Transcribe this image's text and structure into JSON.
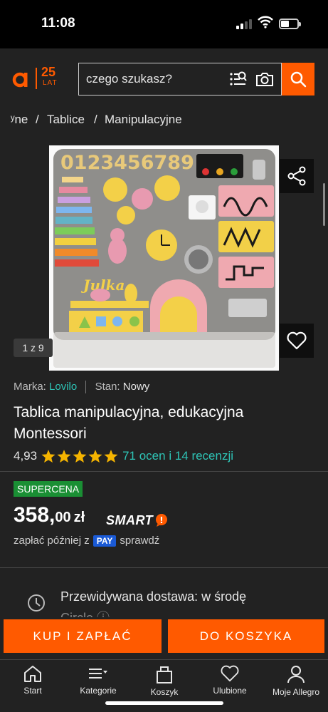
{
  "status_bar": {
    "time": "11:08"
  },
  "header": {
    "logo_number": "25",
    "logo_sub": "LAT",
    "search_placeholder": "czego szukasz?"
  },
  "breadcrumb": [
    "ʸne",
    "/",
    "Tablice",
    "/",
    "Manipulacyjne"
  ],
  "gallery": {
    "counter": "1 z 9",
    "image_text": {
      "digits": "0123456789",
      "name": "Julka"
    }
  },
  "product": {
    "brand_label": "Marka:",
    "brand": "Lovilo",
    "condition_label": "Stan:",
    "condition": "Nowy",
    "title": "Tablica manipulacyjna, edukacyjna Montessori",
    "rating_value": "4,93",
    "stars": 5,
    "rating_link": "71 ocen i 14 recenzji"
  },
  "pricing": {
    "badge": "SUPERCENA",
    "price_int": "358,",
    "price_dec": "00",
    "currency": "zł",
    "smart": "SMART",
    "smart_mark": "!",
    "pay_later_prefix": "zapłać później z",
    "pay_badge": "PAY",
    "pay_later_link": "sprawdź"
  },
  "delivery": {
    "text": "Przewidywana dostawa: w środę",
    "partial_line": "Circle ⓘ"
  },
  "actions": {
    "buy_now": "KUP I ZAPŁAĆ",
    "add_to_cart": "DO KOSZYKA"
  },
  "tabbar": {
    "items": [
      {
        "label": "Start",
        "icon": "home-icon"
      },
      {
        "label": "Kategorie",
        "icon": "menu-icon"
      },
      {
        "label": "Koszyk",
        "icon": "cart-icon"
      },
      {
        "label": "Ulubione",
        "icon": "heart-icon"
      },
      {
        "label": "Moje Allegro",
        "icon": "user-icon"
      }
    ]
  },
  "colors": {
    "accent": "#ff5a00",
    "link": "#2ec4b6",
    "star": "#f5b400",
    "badge_green": "#1a8f34",
    "pay_blue": "#1a5ad6",
    "background": "#222222"
  }
}
